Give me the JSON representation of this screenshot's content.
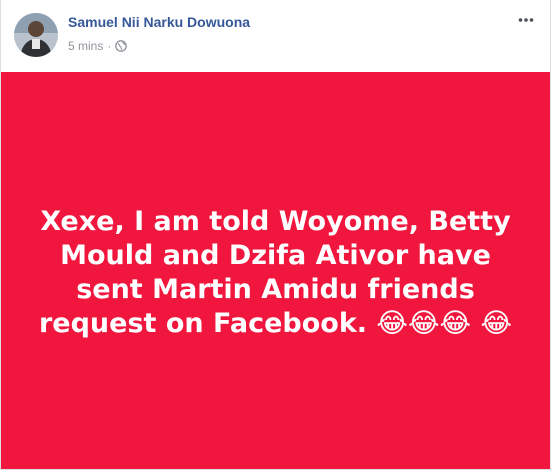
{
  "post": {
    "author_name": "Samuel Nii Narku Dowuona",
    "timestamp": "5 mins",
    "separator": "·",
    "privacy_icon": "globe-icon",
    "more_icon": "more-options-icon",
    "status_text": "Xexe, I am told Woyome, Betty Mould and Dzifa Ativor have sent Martin Amidu friends request on Facebook. 😂😂😂 😂",
    "background_color": "#f0163e",
    "text_color": "#ffffff",
    "author_color": "#365899"
  }
}
